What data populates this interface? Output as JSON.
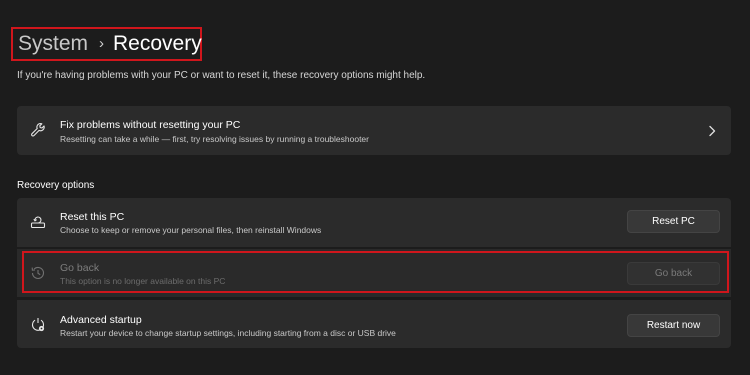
{
  "breadcrumb": {
    "parent": "System",
    "separator": "›",
    "current": "Recovery"
  },
  "intro_text": "If you're having problems with your PC or want to reset it, these recovery options might help.",
  "fix_card": {
    "icon": "wrench-icon",
    "title": "Fix problems without resetting your PC",
    "description": "Resetting can take a while — first, try resolving issues by running a troubleshooter"
  },
  "recovery_options": {
    "heading": "Recovery options",
    "items": [
      {
        "icon": "reset-pc-icon",
        "title": "Reset this PC",
        "description": "Choose to keep or remove your personal files, then reinstall Windows",
        "button": "Reset PC",
        "enabled": true
      },
      {
        "icon": "history-icon",
        "title": "Go back",
        "description": "This option is no longer available on this PC",
        "button": "Go back",
        "enabled": false
      },
      {
        "icon": "advanced-startup-icon",
        "title": "Advanced startup",
        "description": "Restart your device to change startup settings, including starting from a disc or USB drive",
        "button": "Restart now",
        "enabled": true
      }
    ]
  },
  "colors": {
    "background": "#1c1c1c",
    "card": "#2b2b2b",
    "highlight_border": "#d0161c"
  }
}
